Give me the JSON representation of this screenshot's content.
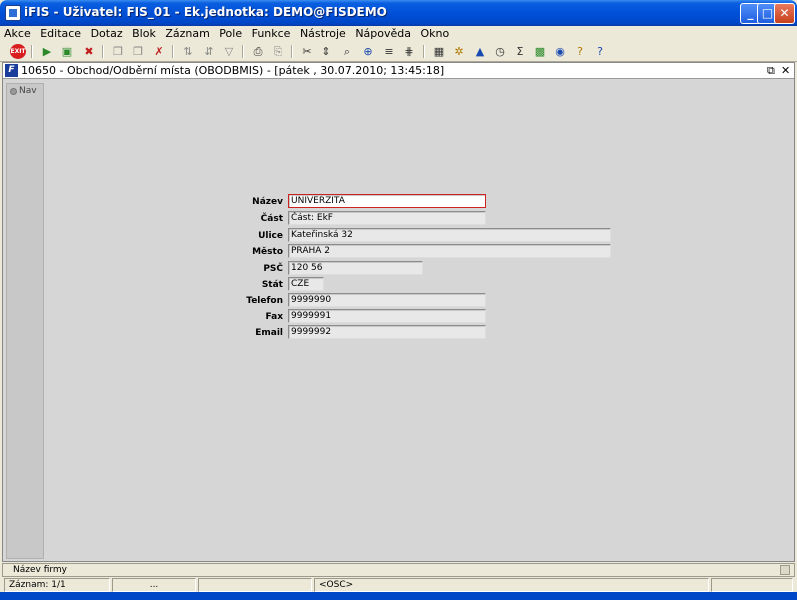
{
  "window": {
    "title": "iFIS - Uživatel: FIS_01 - Ek.jednotka: DEMO@FISDEMO",
    "minimize": "_",
    "maximize": "□",
    "close": "✕"
  },
  "menu": [
    "Akce",
    "Editace",
    "Dotaz",
    "Blok",
    "Záznam",
    "Pole",
    "Funkce",
    "Nástroje",
    "Nápověda",
    "Okno"
  ],
  "toolbar": {
    "exit_label": "EXIT"
  },
  "form_window": {
    "title": "10650 - Obchod/Odběrní místa (OBODBMIS) - [pátek , 30.07.2010; 13:45:18]",
    "icon_letter": "F",
    "restore": "⧉",
    "close": "✕",
    "nav_label": "Nav"
  },
  "form": {
    "nazev": {
      "label": "Název",
      "value": "UNIVERZITA"
    },
    "cast": {
      "label": "Část",
      "value": "Část: EkF"
    },
    "ulice": {
      "label": "Ulice",
      "value": "Kateřinská 32"
    },
    "mesto": {
      "label": "Město",
      "value": "PRAHA 2"
    },
    "psc": {
      "label": "PSČ",
      "value": "120 56"
    },
    "stat": {
      "label": "Stát",
      "value": "CZE"
    },
    "telefon": {
      "label": "Telefon",
      "value": "9999990"
    },
    "fax": {
      "label": "Fax",
      "value": "9999991"
    },
    "email": {
      "label": "Email",
      "value": "9999992"
    }
  },
  "status": {
    "hint": "Název firmy",
    "record": "Záznam: 1/1",
    "dots": "...",
    "mode": "<OSC>"
  }
}
